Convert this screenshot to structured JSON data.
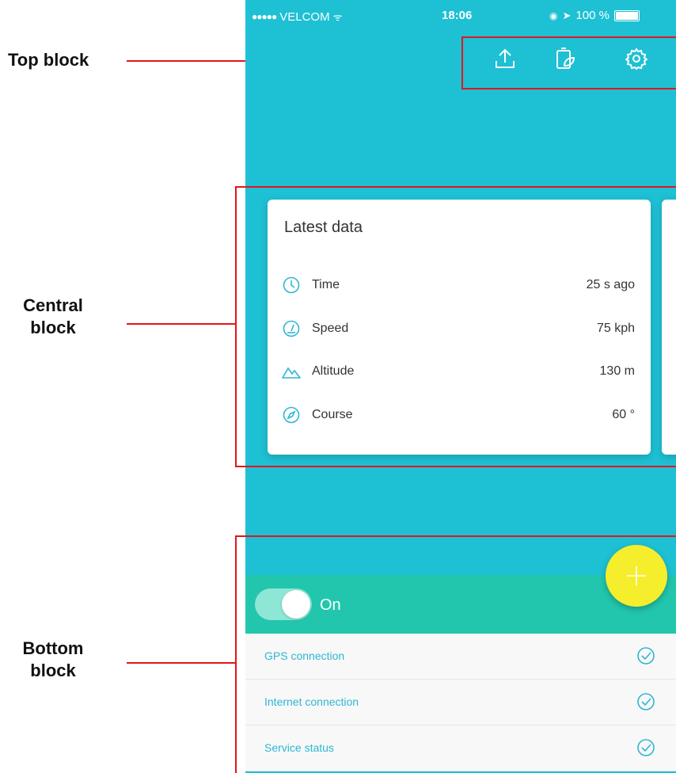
{
  "annotations": {
    "top": "Top block",
    "central_line1": "Central",
    "central_line2": "block",
    "bottom_line1": "Bottom",
    "bottom_line2": "block"
  },
  "statusbar": {
    "carrier": "VELCOM",
    "time": "18:06",
    "battery": "100 %"
  },
  "top_icons": [
    "upload-icon",
    "battery-eco-icon",
    "gear-icon"
  ],
  "card": {
    "title": "Latest data",
    "rows": [
      {
        "icon": "clock-icon",
        "label": "Time",
        "value": "25 s ago"
      },
      {
        "icon": "speedometer-icon",
        "label": "Speed",
        "value": "75 kph"
      },
      {
        "icon": "mountain-icon",
        "label": "Altitude",
        "value": "130 m"
      },
      {
        "icon": "compass-icon",
        "label": "Course",
        "value": "60 °"
      }
    ]
  },
  "toggle": {
    "label": "On",
    "state": "on"
  },
  "status_list": [
    {
      "label": "GPS connection",
      "ok": true
    },
    {
      "label": "Internet connection",
      "ok": true
    },
    {
      "label": "Service status",
      "ok": true
    }
  ],
  "colors": {
    "background": "#1ec0d4",
    "toggle_bar": "#22c6ad",
    "fab": "#f5ee2c",
    "accent_text": "#2db7d3",
    "annotation": "#e3161a"
  }
}
